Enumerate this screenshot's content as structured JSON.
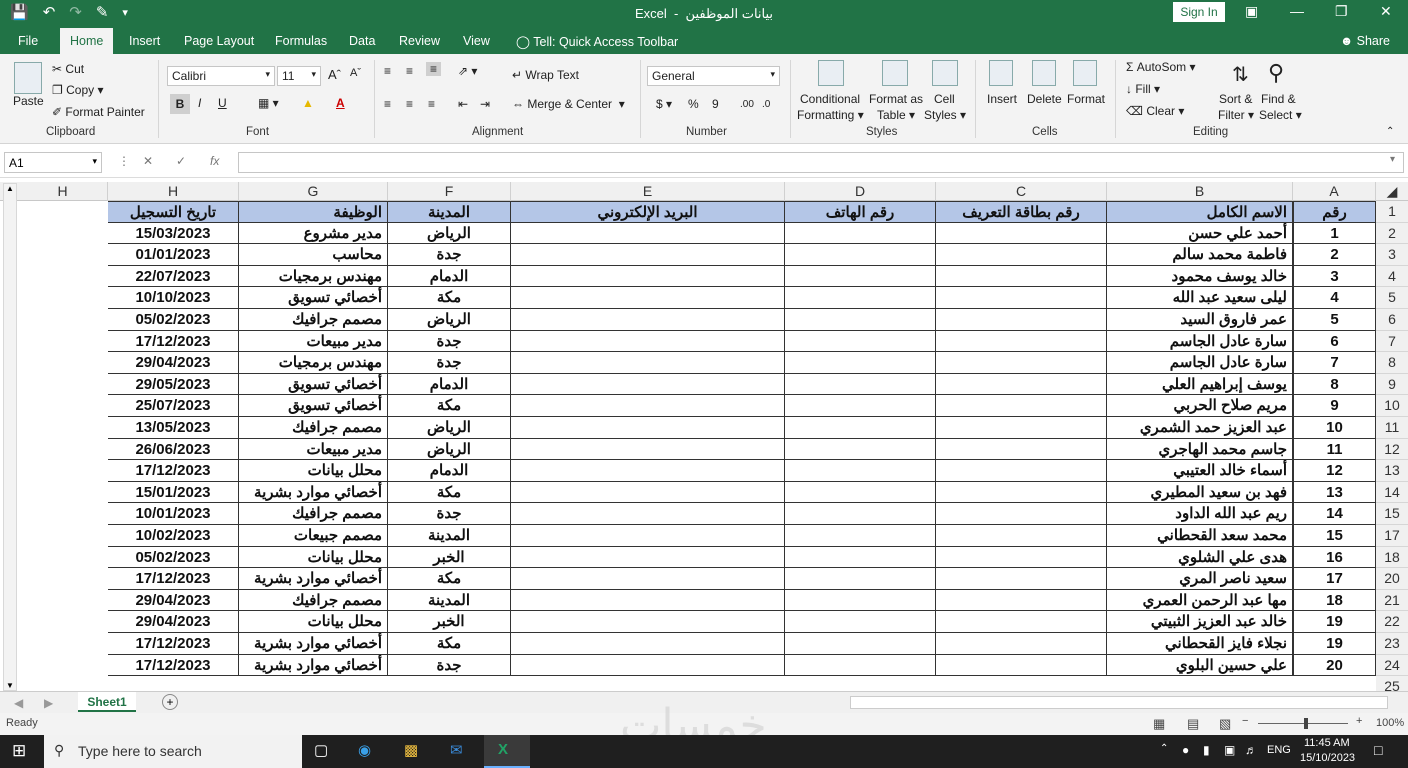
{
  "app": {
    "name": "Excel",
    "file_title": "بيانات الموظفين",
    "sign_in": "Sign In",
    "share": "Share"
  },
  "tabs": [
    "File",
    "Home",
    "Insert",
    "Page Layout",
    "Formulas",
    "Data",
    "Review",
    "View"
  ],
  "tell": "Tell: Quick Access Toolbar",
  "ribbon": {
    "clipboard": {
      "paste": "Paste",
      "cut": "Cut",
      "copy": "Copy",
      "format_painter": "Format Painter",
      "label": "Clipboard"
    },
    "font": {
      "name": "Calibri",
      "size": "11",
      "label": "Font",
      "bold": "B",
      "italic": "I",
      "underline": "U"
    },
    "alignment": {
      "wrap": "Wrap Text",
      "merge": "Merge & Center",
      "label": "Alignment"
    },
    "number": {
      "format": "General",
      "currency": "$",
      "percent": "%",
      "comma": "9",
      "label": "Number"
    },
    "styles": {
      "conditional": "Conditional",
      "formatting": "Formatting",
      "format_as": "Format as",
      "table": "Table",
      "cell": "Cell",
      "cell_styles": "Styles",
      "label": "Styles"
    },
    "cells": {
      "insert": "Insert",
      "delete": "Delete",
      "format": "Format",
      "label": "Cells"
    },
    "editing": {
      "autosum": "AutoSom",
      "fill": "Fill",
      "clear": "Clear",
      "sort": "Sort &",
      "filter": "Filter",
      "find": "Find &",
      "select": "Select",
      "label": "Editing"
    }
  },
  "formula_bar": {
    "name_box": "A1",
    "fx": "fx",
    "value": ""
  },
  "columns": [
    "A",
    "B",
    "C",
    "D",
    "E",
    "F",
    "G",
    "H",
    "H"
  ],
  "header_row": {
    "A": "رقم",
    "B": "الاسم الكامل",
    "C": "رقم بطاقة التعريف",
    "D": "رقم الهاتف",
    "E": "البريد الإلكتروني",
    "F": "المدينة",
    "G": "الوظيفة",
    "H": "تاريخ التسجيل"
  },
  "row_numbers": [
    "1",
    "2",
    "3",
    "4",
    "5",
    "6",
    "7",
    "8",
    "9",
    "10",
    "11",
    "12",
    "13",
    "14",
    "15",
    "17",
    "18",
    "20",
    "21",
    "22",
    "23",
    "24",
    "25"
  ],
  "rows": [
    {
      "a": "1",
      "b": "أحمد علي حسن",
      "f": "الرياض",
      "g": "مدير مشروع",
      "h": "15/03/2023"
    },
    {
      "a": "2",
      "b": "فاطمة محمد سالم",
      "f": "جدة",
      "g": "محاسب",
      "h": "01/01/2023"
    },
    {
      "a": "3",
      "b": "خالد يوسف محمود",
      "f": "الدمام",
      "g": "مهندس برمجيات",
      "h": "22/07/2023"
    },
    {
      "a": "4",
      "b": "ليلى سعيد عبد الله",
      "f": "مكة",
      "g": "أخصائي تسويق",
      "h": "10/10/2023"
    },
    {
      "a": "5",
      "b": "عمر فاروق السيد",
      "f": "الرياض",
      "g": "مصمم جرافيك",
      "h": "05/02/2023"
    },
    {
      "a": "6",
      "b": "سارة عادل الجاسم",
      "f": "جدة",
      "g": "مدير مبيعات",
      "h": "17/12/2023"
    },
    {
      "a": "7",
      "b": "سارة عادل الجاسم",
      "f": "جدة",
      "g": "مهندس برمجيات",
      "h": "29/04/2023"
    },
    {
      "a": "8",
      "b": "يوسف إبراهيم العلي",
      "f": "الدمام",
      "g": "أخصائي تسويق",
      "h": "29/05/2023"
    },
    {
      "a": "9",
      "b": "مريم صلاح الحربي",
      "f": "مكة",
      "g": "أخصائي تسويق",
      "h": "25/07/2023"
    },
    {
      "a": "10",
      "b": "عبد العزيز حمد الشمري",
      "f": "الرياض",
      "g": "مصمم جرافيك",
      "h": "13/05/2023"
    },
    {
      "a": "11",
      "b": "جاسم محمد الهاجري",
      "f": "الرياض",
      "g": "مدير مبيعات",
      "h": "26/06/2023"
    },
    {
      "a": "12",
      "b": "أسماء خالد العتيبي",
      "f": "الدمام",
      "g": "محلل بيانات",
      "h": "17/12/2023"
    },
    {
      "a": "13",
      "b": "فهد بن سعيد المطيري",
      "f": "مكة",
      "g": "أخصائي موارد بشرية",
      "h": "15/01/2023"
    },
    {
      "a": "14",
      "b": "ريم عبد الله الداود",
      "f": "جدة",
      "g": "مصمم جرافيك",
      "h": "10/01/2023"
    },
    {
      "a": "15",
      "b": "محمد سعد القحطاني",
      "f": "المدينة",
      "g": "مصمم جبيعات",
      "h": "10/02/2023"
    },
    {
      "a": "16",
      "b": "هدى علي الشلوي",
      "f": "الخبر",
      "g": "محلل بيانات",
      "h": "05/02/2023"
    },
    {
      "a": "17",
      "b": "سعيد ناصر المري",
      "f": "مكة",
      "g": "أخصائي موارد بشرية",
      "h": "17/12/2023"
    },
    {
      "a": "18",
      "b": "مها عبد الرحمن العمري",
      "f": "المدينة",
      "g": "مصمم جرافيك",
      "h": "29/04/2023"
    },
    {
      "a": "19",
      "b": "خالد عبد العزيز الثبيتي",
      "f": "الخبر",
      "g": "محلل بيانات",
      "h": "29/04/2023"
    },
    {
      "a": "19",
      "b": "نجلاء فايز القحطاني",
      "f": "مكة",
      "g": "أخصائي موارد بشرية",
      "h": "17/12/2023"
    },
    {
      "a": "20",
      "b": "علي حسين البلوي",
      "f": "جدة",
      "g": "أخصائي موارد بشرية",
      "h": "17/12/2023"
    }
  ],
  "sheet": {
    "tab": "Sheet1",
    "add": "+"
  },
  "status": {
    "ready": "Ready",
    "zoom": "100%"
  },
  "taskbar": {
    "search": "Type here to search",
    "lang": "ENG",
    "time": "11:45 AM",
    "date": "15/10/2023"
  },
  "watermark": "خمسات"
}
